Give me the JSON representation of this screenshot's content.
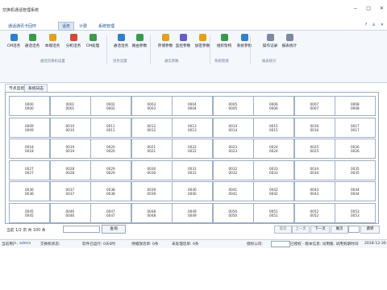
{
  "app": {
    "title": "交换机通话管理系统"
  },
  "menu": {
    "items": [
      "通话通讯卡回环",
      "话务",
      "计费",
      "系统管理"
    ],
    "active_index": 1,
    "right_icons": [
      "help-icon",
      "user-icon",
      "close-icon"
    ]
  },
  "ribbon": {
    "buttons": [
      {
        "label": "CM话务",
        "icon": "phone-list-icon",
        "color": "#2f7fd0"
      },
      {
        "label": "通话话务",
        "icon": "call-icon",
        "color": "#3a9a4a"
      },
      {
        "label": "本端话务",
        "icon": "local-icon",
        "color": "#e0a020"
      },
      {
        "label": "分机话务",
        "icon": "extension-icon",
        "color": "#d04a3a"
      },
      {
        "label": "CM处理",
        "icon": "process-icon",
        "color": "#3a9a4a"
      },
      {
        "label": "通话话务",
        "icon": "call-icon",
        "color": "#2f7fd0"
      },
      {
        "label": "路由参数",
        "icon": "route-icon",
        "color": "#3a9a4a"
      },
      {
        "label": "存储参数",
        "icon": "storage-icon",
        "color": "#e0a020"
      },
      {
        "label": "监控参数",
        "icon": "monitor-icon",
        "color": "#6a5ac8"
      },
      {
        "label": "加密参数",
        "icon": "lock-icon",
        "color": "#e0a020"
      },
      {
        "label": "组织架构",
        "icon": "org-icon",
        "color": "#3a9a4a"
      },
      {
        "label": "系统参数",
        "icon": "settings-icon",
        "color": "#2f7fd0"
      },
      {
        "label": "操作记录",
        "icon": "log-icon",
        "color": "#7a8aa0"
      },
      {
        "label": "报表统计",
        "icon": "chart-icon",
        "color": "#7a8aa0"
      }
    ],
    "groups": [
      "通话交换机设置",
      "话务流量",
      "通信参数",
      "系统管理",
      "报表统计"
    ]
  },
  "subtabs": [
    "节点监控",
    "系统日志"
  ],
  "grid": {
    "rows": [
      [
        "0000",
        "0001",
        "0002",
        "0003",
        "0004",
        "0005",
        "0006",
        "0007",
        "0008"
      ],
      [
        "0009",
        "0010",
        "0011",
        "0012",
        "0013",
        "0014",
        "0015",
        "0016",
        "0017"
      ],
      [
        "0018",
        "0019",
        "0020",
        "0021",
        "0022",
        "0023",
        "0024",
        "0025",
        "0026"
      ],
      [
        "0027",
        "0028",
        "0029",
        "0030",
        "0031",
        "0032",
        "0033",
        "0034",
        "0035"
      ],
      [
        "0036",
        "0037",
        "0038",
        "0039",
        "0040",
        "0041",
        "0042",
        "0043",
        "0044"
      ],
      [
        "0045",
        "0046",
        "0047",
        "0048",
        "0049",
        "0050",
        "0051",
        "0052",
        "0053"
      ]
    ]
  },
  "pager": {
    "summary": "当前 1/2 页 共 100 条",
    "search_label": "查询",
    "first": "首页",
    "prev": "上一页",
    "next": "下一页",
    "last": "尾页",
    "goto": "跳转"
  },
  "status": {
    "user_label": "当前用户:",
    "user": "admin",
    "switch_label": "交换机状态:",
    "uptime_label": "软件已运行: 0天0时",
    "queue_label": "待播放话单: 0条",
    "pending_label": "未处理话单: 0条",
    "company_label": "授权公司:",
    "authorized": "已授权 - 版本信息: 试用版, 试用到期时间:",
    "expiry": "2018-12-30"
  }
}
